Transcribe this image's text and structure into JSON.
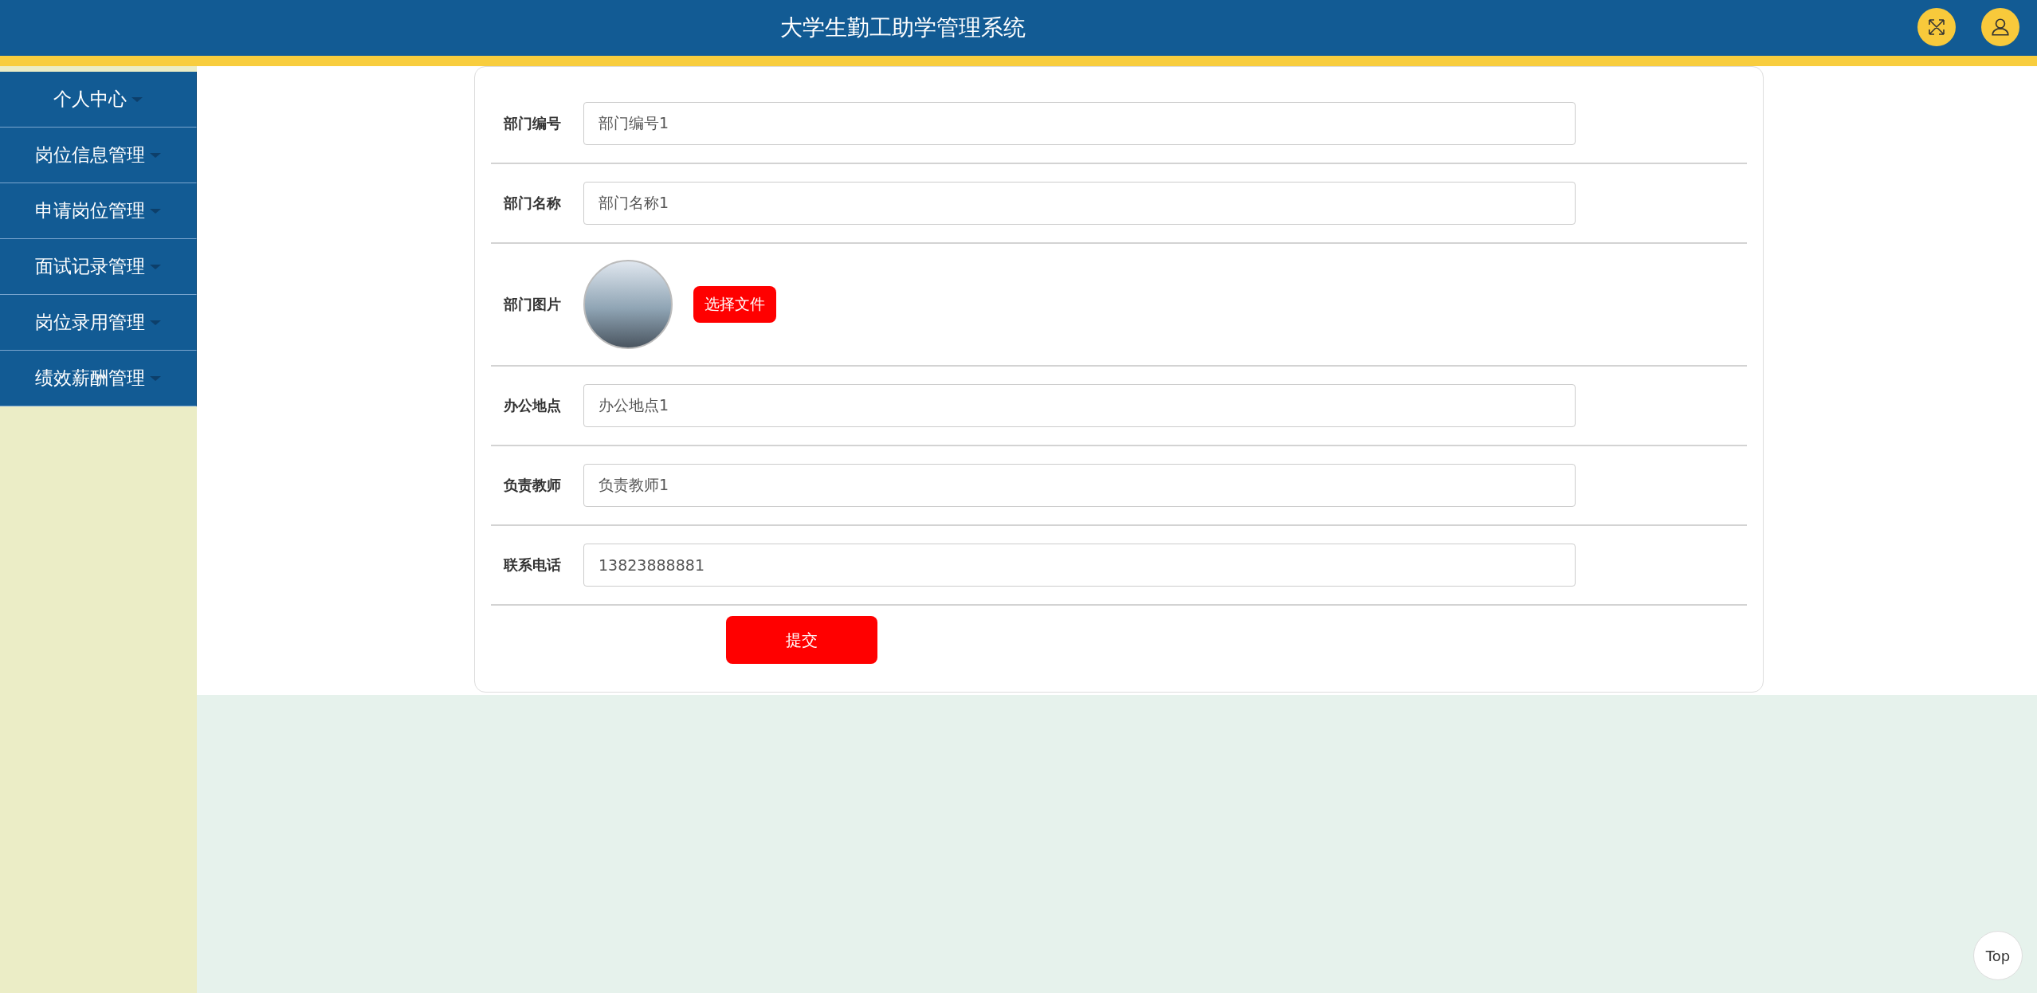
{
  "header": {
    "title": "大学生勤工助学管理系统"
  },
  "sidebar": {
    "items": [
      {
        "label": "个人中心"
      },
      {
        "label": "岗位信息管理"
      },
      {
        "label": "申请岗位管理"
      },
      {
        "label": "面试记录管理"
      },
      {
        "label": "岗位录用管理"
      },
      {
        "label": "绩效薪酬管理"
      }
    ]
  },
  "form": {
    "fields": [
      {
        "kind": "text",
        "label": "部门编号",
        "value": "部门编号1"
      },
      {
        "kind": "text",
        "label": "部门名称",
        "value": "部门名称1"
      },
      {
        "kind": "image",
        "label": "部门图片",
        "button": "选择文件"
      },
      {
        "kind": "text",
        "label": "办公地点",
        "value": "办公地点1"
      },
      {
        "kind": "text",
        "label": "负责教师",
        "value": "负责教师1"
      },
      {
        "kind": "text",
        "label": "联系电话",
        "value": "13823888881"
      }
    ],
    "submit": "提交"
  },
  "back_to_top": "Top"
}
